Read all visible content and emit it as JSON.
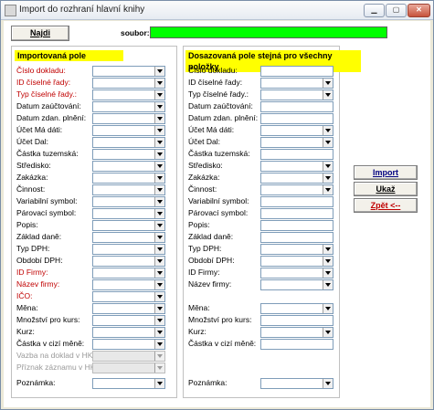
{
  "window": {
    "title": "Import do rozhraní hlavní knihy"
  },
  "toolbar": {
    "find_label": "Najdi",
    "file_label": "soubor:"
  },
  "left": {
    "header": "Importovaná pole",
    "fields": [
      {
        "label": "Číslo dokladu:",
        "style": "red"
      },
      {
        "label": "ID číselné řady:",
        "style": "red"
      },
      {
        "label": "Typ číselné řady.:",
        "style": "red"
      },
      {
        "label": "Datum zaúčtování:",
        "style": "normal"
      },
      {
        "label": "Datum zdan. plnění:",
        "style": "normal"
      },
      {
        "label": "Účet Má dáti:",
        "style": "normal"
      },
      {
        "label": "Účet Dal:",
        "style": "normal"
      },
      {
        "label": "Částka tuzemská:",
        "style": "normal"
      },
      {
        "label": "Středisko:",
        "style": "normal"
      },
      {
        "label": "Zakázka:",
        "style": "normal"
      },
      {
        "label": "Činnost:",
        "style": "normal"
      },
      {
        "label": "Variabilní symbol:",
        "style": "normal"
      },
      {
        "label": "Párovací symbol:",
        "style": "normal"
      },
      {
        "label": "Popis:",
        "style": "normal"
      },
      {
        "label": "Základ daně:",
        "style": "normal"
      },
      {
        "label": "Typ DPH:",
        "style": "normal"
      },
      {
        "label": "Období DPH:",
        "style": "normal"
      },
      {
        "label": "ID Firmy:",
        "style": "red"
      },
      {
        "label": "Název firmy:",
        "style": "red"
      },
      {
        "label": "IČO:",
        "style": "red"
      },
      {
        "label": "Měna:",
        "style": "normal"
      },
      {
        "label": "Množství pro kurs:",
        "style": "normal"
      },
      {
        "label": "Kurz:",
        "style": "normal"
      },
      {
        "label": "Částka v cizí měně:",
        "style": "normal"
      },
      {
        "label": "Vazba na doklad v HK:",
        "style": "disabled"
      },
      {
        "label": "Příznak záznamu v HK:",
        "style": "disabled"
      },
      {
        "label": "Poznámka:",
        "style": "normal"
      }
    ]
  },
  "right": {
    "header": "Dosazovaná pole stejná pro všechny položky",
    "fields": [
      {
        "label": "Číslo dokladu:",
        "control": "text"
      },
      {
        "label": "ID číselné řady:",
        "control": "combo"
      },
      {
        "label": "Typ číselné řady.:",
        "control": "combo"
      },
      {
        "label": "Datum zaúčtování:",
        "control": "text"
      },
      {
        "label": "Datum zdan. plnění:",
        "control": "text"
      },
      {
        "label": "Účet Má dáti:",
        "control": "combo"
      },
      {
        "label": "Účet Dal:",
        "control": "combo"
      },
      {
        "label": "Částka tuzemská:",
        "control": "text"
      },
      {
        "label": "Středisko:",
        "control": "combo"
      },
      {
        "label": "Zakázka:",
        "control": "combo"
      },
      {
        "label": "Činnost:",
        "control": "combo"
      },
      {
        "label": "Variabilní symbol:",
        "control": "text"
      },
      {
        "label": "Párovací symbol:",
        "control": "text"
      },
      {
        "label": "Popis:",
        "control": "text"
      },
      {
        "label": "Základ daně:",
        "control": "text"
      },
      {
        "label": "Typ DPH:",
        "control": "combo"
      },
      {
        "label": "Období DPH:",
        "control": "combo"
      },
      {
        "label": "ID Firmy:",
        "control": "combo"
      },
      {
        "label": "Název firmy:",
        "control": "combo"
      },
      {
        "label": "Měna:",
        "control": "combo"
      },
      {
        "label": "Množství pro kurs:",
        "control": "text"
      },
      {
        "label": "Kurz:",
        "control": "combo"
      },
      {
        "label": "Částka v cizí měně:",
        "control": "text"
      },
      {
        "label": "Poznámka:",
        "control": "combo"
      }
    ]
  },
  "actions": {
    "import_label": "Import",
    "show_label": "Ukaž",
    "back_label": "Zpět <--"
  },
  "colors": {
    "header_bg": "#ffff00",
    "file_bg": "#00ff00",
    "required_text": "#c00000"
  }
}
